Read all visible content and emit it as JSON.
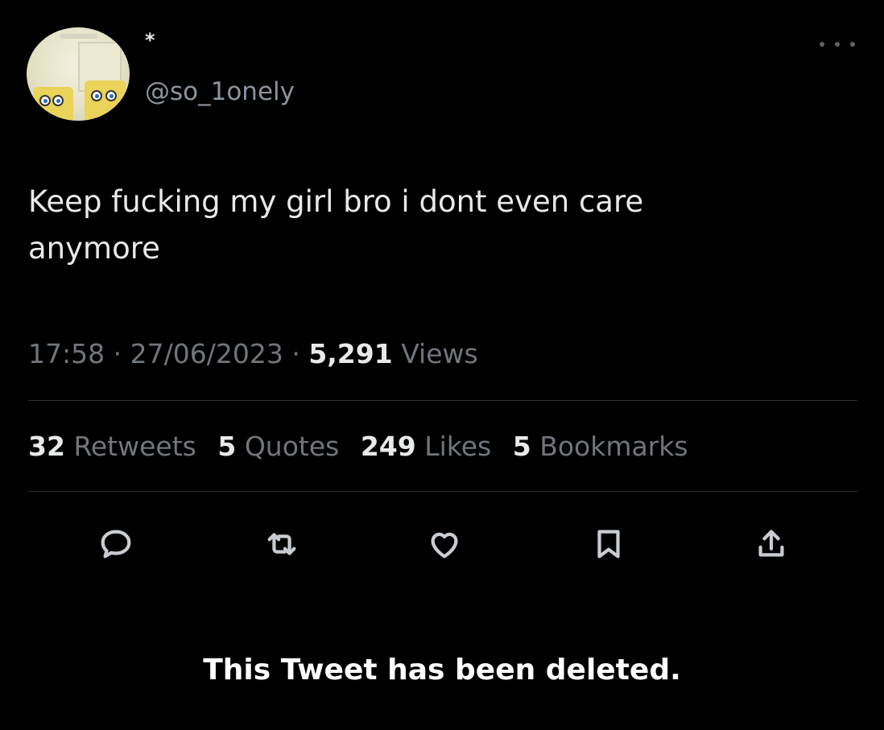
{
  "tweet": {
    "display_name": "*",
    "handle": "@so_1onely",
    "text_line1": "Keep fucking my girl bro i dont even care",
    "text_line2": "anymore",
    "time": "17:58",
    "date": "27/06/2023",
    "views_count": "5,291",
    "views_label": "Views",
    "separator": "·"
  },
  "stats": {
    "retweets_count": "32",
    "retweets_label": "Retweets",
    "quotes_count": "5",
    "quotes_label": "Quotes",
    "likes_count": "249",
    "likes_label": "Likes",
    "bookmarks_count": "5",
    "bookmarks_label": "Bookmarks"
  },
  "actions": {
    "icons": [
      "reply-icon",
      "retweet-icon",
      "like-icon",
      "bookmark-icon",
      "share-icon"
    ]
  },
  "notice": {
    "deleted_text": "This Tweet has been deleted."
  },
  "colors": {
    "background": "#000000",
    "primary_text": "#e7e9ea",
    "secondary_text": "#71767b",
    "divider": "#2f3336",
    "icon": "#c9cdd1"
  }
}
